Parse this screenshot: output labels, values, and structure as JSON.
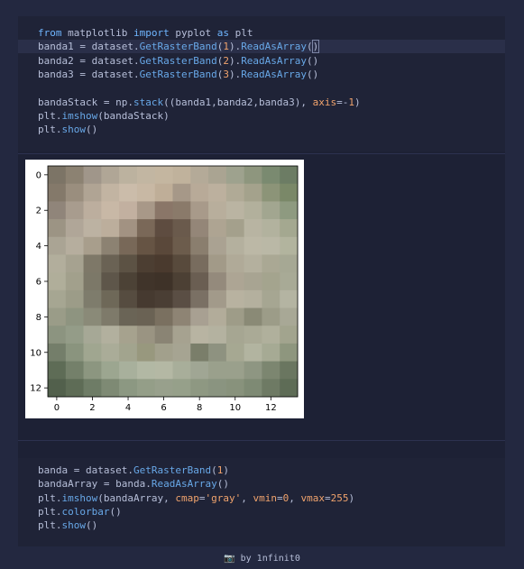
{
  "cell1": {
    "lines": [
      [
        {
          "t": "from",
          "c": "kw"
        },
        {
          "t": " matplotlib "
        },
        {
          "t": "import",
          "c": "kw"
        },
        {
          "t": " pyplot "
        },
        {
          "t": "as",
          "c": "kw"
        },
        {
          "t": " plt"
        }
      ],
      [
        {
          "t": "banda1 = dataset."
        },
        {
          "t": "GetRasterBand",
          "c": "fn"
        },
        {
          "t": "("
        },
        {
          "t": "1",
          "c": "num"
        },
        {
          "t": ")."
        },
        {
          "t": "ReadAsArray",
          "c": "fn"
        },
        {
          "t": "("
        },
        {
          "t": ")",
          "c": "cursor"
        }
      ],
      [
        {
          "t": "banda2 = dataset."
        },
        {
          "t": "GetRasterBand",
          "c": "fn"
        },
        {
          "t": "("
        },
        {
          "t": "2",
          "c": "num"
        },
        {
          "t": ")."
        },
        {
          "t": "ReadAsArray",
          "c": "fn"
        },
        {
          "t": "()"
        }
      ],
      [
        {
          "t": "banda3 = dataset."
        },
        {
          "t": "GetRasterBand",
          "c": "fn"
        },
        {
          "t": "("
        },
        {
          "t": "3",
          "c": "num"
        },
        {
          "t": ")."
        },
        {
          "t": "ReadAsArray",
          "c": "fn"
        },
        {
          "t": "()"
        }
      ],
      [],
      [
        {
          "t": "bandaStack = np."
        },
        {
          "t": "stack",
          "c": "fn"
        },
        {
          "t": "((banda1,banda2,banda3), "
        },
        {
          "t": "axis",
          "c": "arg"
        },
        {
          "t": "=-"
        },
        {
          "t": "1",
          "c": "num"
        },
        {
          "t": ")"
        }
      ],
      [
        {
          "t": "plt."
        },
        {
          "t": "imshow",
          "c": "fn"
        },
        {
          "t": "(bandaStack)"
        }
      ],
      [
        {
          "t": "plt."
        },
        {
          "t": "show",
          "c": "fn"
        },
        {
          "t": "()"
        }
      ]
    ]
  },
  "cell2": {
    "lines": [
      [
        {
          "t": "banda = dataset."
        },
        {
          "t": "GetRasterBand",
          "c": "fn"
        },
        {
          "t": "("
        },
        {
          "t": "1",
          "c": "num"
        },
        {
          "t": ")"
        }
      ],
      [
        {
          "t": "bandaArray = banda."
        },
        {
          "t": "ReadAsArray",
          "c": "fn"
        },
        {
          "t": "()"
        }
      ],
      [
        {
          "t": "plt."
        },
        {
          "t": "imshow",
          "c": "fn"
        },
        {
          "t": "(bandaArray, "
        },
        {
          "t": "cmap",
          "c": "arg"
        },
        {
          "t": "="
        },
        {
          "t": "'gray'",
          "c": "str"
        },
        {
          "t": ", "
        },
        {
          "t": "vmin",
          "c": "arg"
        },
        {
          "t": "="
        },
        {
          "t": "0",
          "c": "num"
        },
        {
          "t": ", "
        },
        {
          "t": "vmax",
          "c": "arg"
        },
        {
          "t": "="
        },
        {
          "t": "255",
          "c": "num"
        },
        {
          "t": ")"
        }
      ],
      [
        {
          "t": "plt."
        },
        {
          "t": "colorbar",
          "c": "fn"
        },
        {
          "t": "()"
        }
      ],
      [
        {
          "t": "plt."
        },
        {
          "t": "show",
          "c": "fn"
        },
        {
          "t": "()"
        }
      ]
    ]
  },
  "colors": {
    "keyword": "#6fb6ff",
    "function": "#68a8e8",
    "number": "#f0a36d",
    "background": "#232840"
  },
  "chart_data": {
    "type": "heatmap",
    "title": "",
    "xlabel": "",
    "ylabel": "",
    "x_ticks": [
      "0",
      "2",
      "4",
      "6",
      "8",
      "10",
      "12"
    ],
    "y_ticks": [
      "0",
      "2",
      "4",
      "6",
      "8",
      "10",
      "12"
    ],
    "rows": 13,
    "cols": 14,
    "pixels": [
      [
        "#7c7466",
        "#8c8272",
        "#a0968a",
        "#b0a696",
        "#bcb29f",
        "#c2b6a2",
        "#c4b6a0",
        "#c0b29c",
        "#b4aa98",
        "#aaa492",
        "#9ea28e",
        "#8e967e",
        "#7a8a70",
        "#6c7c64"
      ],
      [
        "#84796a",
        "#9a8e7e",
        "#b0a494",
        "#c2b4a2",
        "#cbbcaa",
        "#c8b8a4",
        "#bfae98",
        "#a69888",
        "#b8aa98",
        "#bcb09e",
        "#b0aa96",
        "#a4a28c",
        "#8c9478",
        "#7a8868"
      ],
      [
        "#90857a",
        "#a89c8e",
        "#bcae9e",
        "#c8b8a6",
        "#c2b0a0",
        "#a89888",
        "#8a7668",
        "#8a7a6a",
        "#a89a8a",
        "#b8ae9c",
        "#bab4a2",
        "#b2b09c",
        "#a2a690",
        "#8e9a80"
      ],
      [
        "#9c9484",
        "#b0a698",
        "#bcb2a2",
        "#bcae9c",
        "#a29282",
        "#7a6858",
        "#5e4c40",
        "#6a5a4c",
        "#948678",
        "#aea492",
        "#a4a08c",
        "#b8b4a2",
        "#b2b29e",
        "#a4a890"
      ],
      [
        "#aaa494",
        "#b6ae9e",
        "#a89e8c",
        "#8c8272",
        "#786858",
        "#665444",
        "#5a483a",
        "#6c5c4c",
        "#8a7e6e",
        "#aaa292",
        "#b4b09e",
        "#bcb8a6",
        "#bab8a6",
        "#b2b49e"
      ],
      [
        "#b2ae9c",
        "#a6a290",
        "#7e7868",
        "#6a6254",
        "#5c5244",
        "#4c3e32",
        "#4a3a2e",
        "#584a3c",
        "#786c5e",
        "#a29a88",
        "#b0aa98",
        "#b4b09e",
        "#aaa894",
        "#a6a894"
      ],
      [
        "#b0ae9a",
        "#a2a08c",
        "#7c7868",
        "#5e564a",
        "#4c4236",
        "#40342a",
        "#3e3228",
        "#4c4034",
        "#6a5e52",
        "#948a7c",
        "#ada594",
        "#a8a492",
        "#a4a48e",
        "#a8aa96"
      ],
      [
        "#a6a692",
        "#9c9c88",
        "#7e7c6c",
        "#6e6858",
        "#564c40",
        "#463a30",
        "#4a3e34",
        "#5a4e44",
        "#7a7064",
        "#a29a8a",
        "#b8b2a0",
        "#b4b09e",
        "#a6a692",
        "#b4b4a2"
      ],
      [
        "#9a9c88",
        "#8e9480",
        "#8a8a78",
        "#7e7a6a",
        "#6a6456",
        "#6a6254",
        "#7a7060",
        "#8e8474",
        "#a8a092",
        "#b2ac9a",
        "#9e9c88",
        "#8a8a76",
        "#9c9c88",
        "#a8a896"
      ],
      [
        "#8c9480",
        "#949c88",
        "#a6a896",
        "#b2b09e",
        "#a6a28e",
        "#9a9482",
        "#8a8474",
        "#a6a290",
        "#b8b4a2",
        "#b4b2a0",
        "#a6a692",
        "#aaaa96",
        "#b0b09c",
        "#a2a48e"
      ],
      [
        "#747e6a",
        "#8a947e",
        "#a0a690",
        "#aaac98",
        "#a2a48e",
        "#98987e",
        "#a2a08c",
        "#a6a492",
        "#7a7e6a",
        "#8e9280",
        "#a6a892",
        "#b2b4a0",
        "#a6aa94",
        "#8e967e"
      ],
      [
        "#5e6c56",
        "#74806a",
        "#8c9680",
        "#9ca690",
        "#a8b09c",
        "#b2b8a4",
        "#b4b8a4",
        "#a8ae9a",
        "#a0a694",
        "#9aa08c",
        "#9aa08c",
        "#8e9682",
        "#7c8670",
        "#6a7660"
      ],
      [
        "#52604c",
        "#5e6c56",
        "#6e7c66",
        "#7e8a74",
        "#8c9882",
        "#949e88",
        "#98a08c",
        "#96a08a",
        "#8e9882",
        "#8a9480",
        "#88927c",
        "#7e8a74",
        "#6e7a64",
        "#5e6c56"
      ]
    ]
  },
  "footer": {
    "icon": "camera-icon",
    "icon_glyph": "📷",
    "text": "by 1nfinit0"
  }
}
